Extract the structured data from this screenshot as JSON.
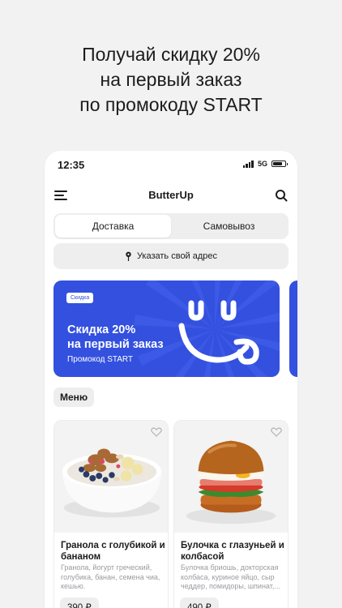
{
  "promo_headline": {
    "line1": "Получай скидку 20%",
    "line2": "на первый заказ",
    "line3": "по промокоду START"
  },
  "status_bar": {
    "time": "12:35",
    "network": "5G",
    "battery_level": 0.75
  },
  "header": {
    "title": "ButterUp",
    "menu_icon": "hamburger-icon",
    "search_icon": "search-icon"
  },
  "delivery_tabs": [
    {
      "label": "Доставка",
      "active": true
    },
    {
      "label": "Самовывоз",
      "active": false
    }
  ],
  "address_button": {
    "label": "Указать свой адрес",
    "icon": "map-pin-icon"
  },
  "banner": {
    "badge": "Скидка",
    "title_line1": "Скидка 20%",
    "title_line2": "на первый заказ",
    "promo_code": "Промокод START",
    "color": "#3350df"
  },
  "menu_chip": {
    "label": "Меню"
  },
  "products": [
    {
      "name": "Гранола с голубикой и бананом",
      "description": "Гранола, йогурт греческий, голубика, банан, семена чиа, кешью.",
      "price": "390 ₽"
    },
    {
      "name": "Булочка с глазуньей и колбасой",
      "description": "Булочка бриошь, докторская колбаса, куриное яйцо, сыр чеддер, помидоры, шпинат,...",
      "price": "490 ₽"
    }
  ],
  "colors": {
    "accent": "#3350df",
    "background": "#f2f2f2",
    "chip": "#eeeeef"
  }
}
